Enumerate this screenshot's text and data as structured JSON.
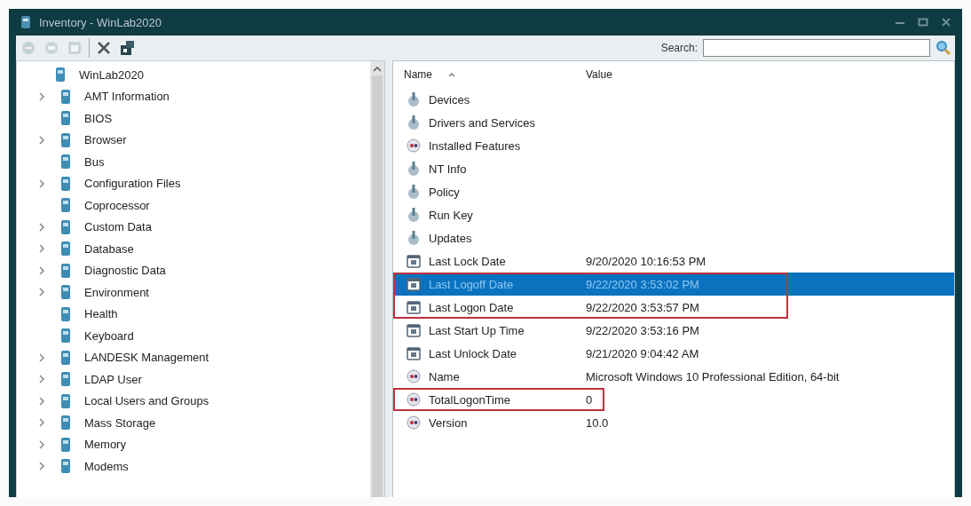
{
  "window": {
    "title": "Inventory - WinLab2020"
  },
  "toolbar": {
    "buttons": [
      {
        "disabled": true
      },
      {
        "disabled": true
      },
      {
        "disabled": true
      },
      {
        "disabled": false
      },
      {
        "disabled": false
      }
    ],
    "search": {
      "label": "Search:"
    }
  },
  "tree": {
    "label": "WinLab2020",
    "children": [
      {
        "label": "AMT Information",
        "kind": "branch"
      },
      {
        "label": "BIOS",
        "kind": "leaf"
      },
      {
        "label": "Browser",
        "kind": "branch"
      },
      {
        "label": "Bus",
        "kind": "leaf"
      },
      {
        "label": "Configuration Files",
        "kind": "branch"
      },
      {
        "label": "Coprocessor",
        "kind": "leaf"
      },
      {
        "label": "Custom Data",
        "kind": "branch"
      },
      {
        "label": "Database",
        "kind": "branch"
      },
      {
        "label": "Diagnostic Data",
        "kind": "branch"
      },
      {
        "label": "Environment",
        "kind": "branch"
      },
      {
        "label": "Health",
        "kind": "leaf"
      },
      {
        "label": "Keyboard",
        "kind": "leaf"
      },
      {
        "label": "LANDESK Management",
        "kind": "branch"
      },
      {
        "label": "LDAP User",
        "kind": "branch"
      },
      {
        "label": "Local Users and Groups",
        "kind": "branch"
      },
      {
        "label": "Mass Storage",
        "kind": "branch"
      },
      {
        "label": "Memory",
        "kind": "branch"
      },
      {
        "label": "Modems",
        "kind": "branch"
      }
    ]
  },
  "list": {
    "columns": [
      "Name",
      "Value"
    ],
    "rows": [
      {
        "kind": "category",
        "name": "Devices",
        "selected": false,
        "outlined": false
      },
      {
        "kind": "category",
        "name": "Drivers and Services",
        "selected": false,
        "outlined": false
      },
      {
        "kind": "property",
        "name": "Installed Features",
        "selected": false,
        "outlined": false
      },
      {
        "kind": "category",
        "name": "NT Info",
        "selected": false,
        "outlined": false
      },
      {
        "kind": "category",
        "name": "Policy",
        "selected": false,
        "outlined": false
      },
      {
        "kind": "category",
        "name": "Run Key",
        "selected": false,
        "outlined": false
      },
      {
        "kind": "category",
        "name": "Updates",
        "selected": false,
        "outlined": false
      },
      {
        "kind": "date",
        "name": "Last Lock Date",
        "value": "9/20/2020 10:16:53 PM",
        "selected": false,
        "outlined": false
      },
      {
        "kind": "date",
        "name": "Last Logoff Date",
        "value": "9/22/2020 3:53:02 PM",
        "selected": true,
        "outlined": true
      },
      {
        "kind": "date",
        "name": "Last Logon Date",
        "value": "9/22/2020 3:53:57 PM",
        "selected": false,
        "outlined": true
      },
      {
        "kind": "date",
        "name": "Last Start Up Time",
        "value": "9/22/2020 3:53:16 PM",
        "selected": false,
        "outlined": false
      },
      {
        "kind": "date",
        "name": "Last Unlock Date",
        "value": "9/21/2020 9:04:42 AM",
        "selected": false,
        "outlined": false
      },
      {
        "kind": "property",
        "name": "Name",
        "value": "Microsoft Windows 10 Professional Edition, 64-bit",
        "selected": false,
        "outlined": false
      },
      {
        "kind": "property",
        "name": "TotalLogonTime",
        "value": "0",
        "selected": false,
        "outlined": true
      },
      {
        "kind": "property",
        "name": "Version",
        "value": "10.0",
        "selected": false,
        "outlined": false
      }
    ]
  }
}
